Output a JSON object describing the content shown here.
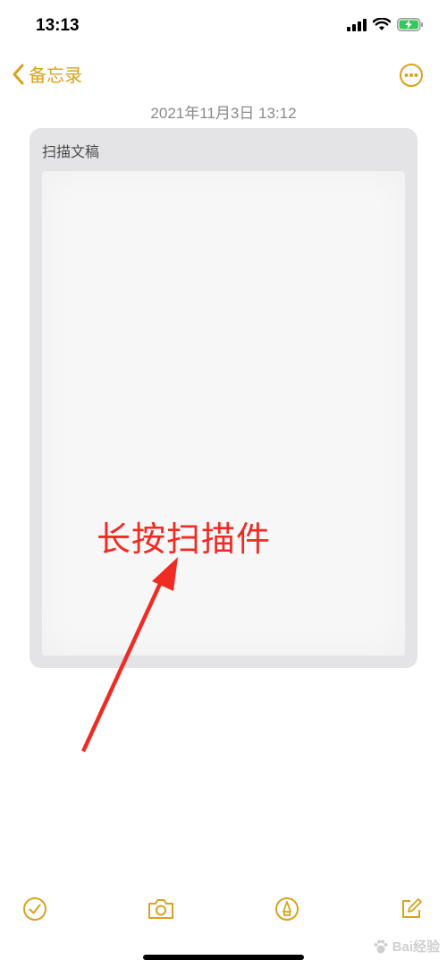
{
  "status_bar": {
    "time": "13:13",
    "battery_color": "#34c759"
  },
  "nav": {
    "back_label": "备忘录",
    "accent_color": "#d9a21b"
  },
  "note": {
    "date": "2021年11月3日 13:12",
    "scan_title": "扫描文稿"
  },
  "annotation": {
    "text": "长按扫描件",
    "color": "#ef2b24"
  },
  "toolbar": {
    "icons": [
      "checklist-icon",
      "camera-icon",
      "markup-icon",
      "compose-icon"
    ]
  },
  "watermark": {
    "text": "Bai经验"
  }
}
